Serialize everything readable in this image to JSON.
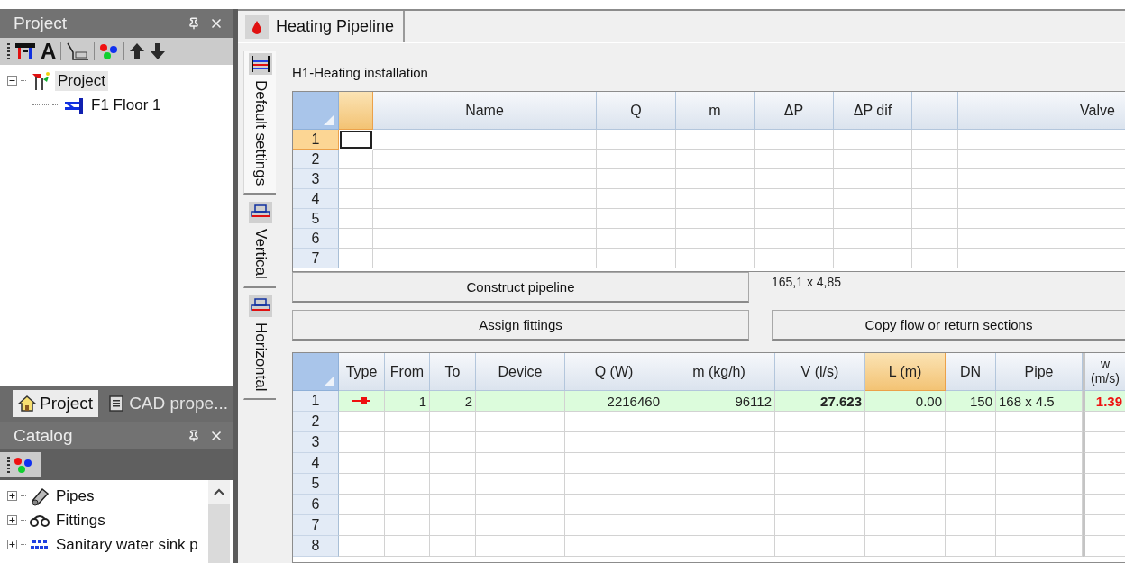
{
  "project_panel": {
    "title": "Project",
    "toolbar": [
      {
        "kind": "legend"
      },
      {
        "kind": "glyph",
        "glyph": "A"
      },
      {
        "kind": "scale"
      },
      {
        "kind": "colors"
      },
      {
        "kind": "up"
      },
      {
        "kind": "down"
      }
    ],
    "tree": [
      {
        "label": "Project",
        "kind": "project",
        "expanded": true,
        "selected": true,
        "children": [
          {
            "label": "F1 Floor 1",
            "kind": "floor",
            "selected": false
          }
        ]
      }
    ],
    "tabs": [
      {
        "label": "Project",
        "kind": "home",
        "selected": true
      },
      {
        "label": "CAD prope...",
        "kind": "sheet",
        "selected": false
      }
    ]
  },
  "catalog_panel": {
    "title": "Catalog",
    "toolbar": [
      {
        "kind": "colors"
      }
    ],
    "tree": [
      {
        "label": "Pipes",
        "kind": "pipe",
        "expanded": false,
        "selected": false
      },
      {
        "label": "Fittings",
        "kind": "fitting",
        "expanded": false,
        "selected": false
      },
      {
        "label": "Sanitary water sink p",
        "kind": "din",
        "expanded": false,
        "selected": false
      }
    ]
  },
  "document_tabs": [
    {
      "label": "Heating Pipeline",
      "selected": true
    }
  ],
  "side_tabs": [
    {
      "label": "Default settings",
      "kind": "settings",
      "selected": true
    },
    {
      "label": "Vertical",
      "kind": "riser",
      "selected": false
    },
    {
      "label": "Horizontal",
      "kind": "riser",
      "selected": false
    }
  ],
  "installation": {
    "title": "H1-Heating installation",
    "columns": [
      {
        "selected": true
      },
      {
        "label": "Name",
        "selected": false
      },
      {
        "label": "Q",
        "selected": false
      },
      {
        "label": "m",
        "selected": false
      },
      {
        "label": "ΔP",
        "selected": false
      },
      {
        "label": "ΔP dif",
        "selected": false
      },
      {
        "selected": false
      },
      {
        "label": "Valve",
        "selected": false
      }
    ],
    "rows": [
      {
        "number": "1",
        "selected": true
      },
      {
        "number": "2",
        "selected": false
      },
      {
        "number": "3",
        "selected": false
      },
      {
        "number": "4",
        "selected": false
      },
      {
        "number": "5",
        "selected": false
      },
      {
        "number": "6",
        "selected": false
      },
      {
        "number": "7",
        "selected": false
      }
    ]
  },
  "construct_button": "Construct pipeline",
  "pipe_size": "165,1 x 4,85",
  "assign_button": "Assign fittings",
  "copy_button": "Copy flow or return sections",
  "sections": {
    "columns": [
      {
        "label": "Type",
        "selected": false
      },
      {
        "label": "From",
        "selected": false
      },
      {
        "label": "To",
        "selected": false
      },
      {
        "label": "Device",
        "selected": false
      },
      {
        "label": "Q (W)",
        "selected": false
      },
      {
        "label": "m (kg/h)",
        "selected": false
      },
      {
        "label": "V (l/s)",
        "selected": false
      },
      {
        "label": "L (m)",
        "selected": true
      },
      {
        "label": "DN",
        "selected": false
      },
      {
        "label": "Pipe",
        "selected": false
      },
      {
        "label": "w (m/s)",
        "selected": false
      }
    ],
    "rows": [
      {
        "number": "1",
        "highlighted": true,
        "cells": [
          {
            "kind": "arrow"
          },
          {
            "kind": "text",
            "text": "1"
          },
          {
            "kind": "text",
            "text": "2"
          },
          {
            "kind": "empty"
          },
          {
            "kind": "text",
            "text": "2216460"
          },
          {
            "kind": "text",
            "text": "96112"
          },
          {
            "kind": "bold",
            "text": "27.623"
          },
          {
            "kind": "text",
            "text": "0.00"
          },
          {
            "kind": "text",
            "text": "150"
          },
          {
            "kind": "text",
            "text": "168 x 4.5"
          },
          {
            "kind": "warning",
            "text": "1.39"
          }
        ]
      },
      {
        "number": "2",
        "highlighted": false
      },
      {
        "number": "3",
        "highlighted": false
      },
      {
        "number": "4",
        "highlighted": false
      },
      {
        "number": "5",
        "highlighted": false
      },
      {
        "number": "6",
        "highlighted": false
      },
      {
        "number": "7",
        "highlighted": false
      },
      {
        "number": "8",
        "highlighted": false
      }
    ]
  }
}
